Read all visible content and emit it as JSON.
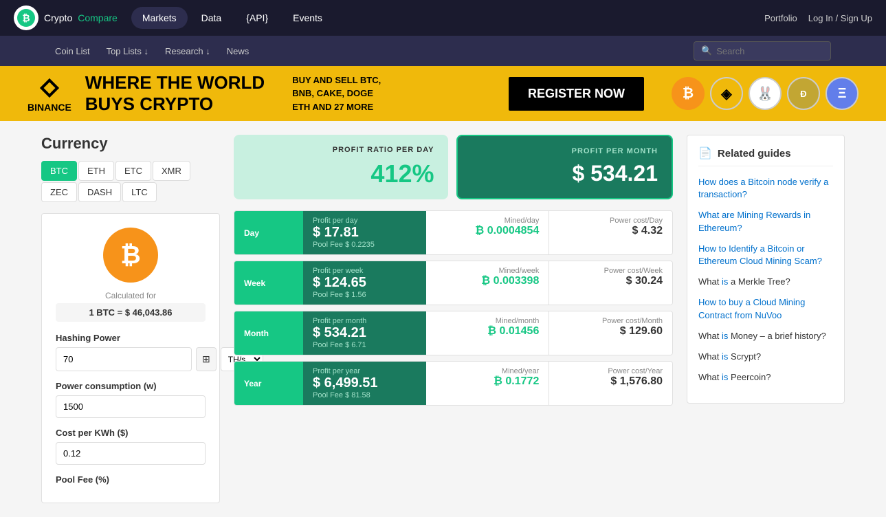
{
  "header": {
    "logo_text_crypto": "Crypto",
    "logo_text_compare": "Compare",
    "nav_items": [
      {
        "label": "Markets",
        "active": true
      },
      {
        "label": "Data"
      },
      {
        "label": "{API}"
      },
      {
        "label": "Events"
      }
    ],
    "portfolio": "Portfolio",
    "login": "Log In / Sign Up"
  },
  "secondary_nav": {
    "items": [
      {
        "label": "Coin List"
      },
      {
        "label": "Top Lists ↓"
      },
      {
        "label": "Research ↓"
      },
      {
        "label": "News"
      }
    ],
    "search_placeholder": "Search"
  },
  "banner": {
    "brand": "BINANCE",
    "headline_line1": "WHERE THE WORLD",
    "headline_line2": "BUYS CRYPTO",
    "sub_text": "BUY AND SELL BTC, BNB, CAKE, DOGE\nETH AND 27 MORE",
    "cta_button": "REGISTER NOW"
  },
  "page": {
    "currency_label": "Currency",
    "tabs": [
      {
        "label": "BTC",
        "active": true
      },
      {
        "label": "ETH"
      },
      {
        "label": "ETC"
      },
      {
        "label": "XMR"
      },
      {
        "label": "ZEC"
      },
      {
        "label": "DASH"
      },
      {
        "label": "LTC"
      }
    ],
    "btc_symbol": "₿",
    "calc_label": "Calculated for",
    "calc_value": "1 BTC = $ 46,043.86",
    "hashing_power_label": "Hashing Power",
    "hashing_value": "70",
    "hashing_unit": "TH/s",
    "power_consumption_label": "Power consumption (w)",
    "power_value": "1500",
    "cost_per_kwh_label": "Cost per KWh ($)",
    "cost_value": "0.12",
    "pool_fee_label": "Pool Fee (%)"
  },
  "profit": {
    "day_label": "PROFIT RATIO PER DAY",
    "day_value": "412%",
    "month_label": "PROFIT PER MONTH",
    "month_value": "$ 534.21",
    "rows": [
      {
        "period": "Day",
        "title": "Profit per day",
        "value": "$ 17.81",
        "pool_fee": "Pool Fee $ 0.2235",
        "mined_label": "Mined/day",
        "mined_value": "₿ 0.0004854",
        "power_label": "Power cost/Day",
        "power_value": "$ 4.32"
      },
      {
        "period": "Week",
        "title": "Profit per week",
        "value": "$ 124.65",
        "pool_fee": "Pool Fee $ 1.56",
        "mined_label": "Mined/week",
        "mined_value": "₿ 0.003398",
        "power_label": "Power cost/Week",
        "power_value": "$ 30.24"
      },
      {
        "period": "Month",
        "title": "Profit per month",
        "value": "$ 534.21",
        "pool_fee": "Pool Fee $ 6.71",
        "mined_label": "Mined/month",
        "mined_value": "₿ 0.01456",
        "power_label": "Power cost/Month",
        "power_value": "$ 129.60"
      },
      {
        "period": "Year",
        "title": "Profit per year",
        "value": "$ 6,499.51",
        "pool_fee": "Pool Fee $ 81.58",
        "mined_label": "Mined/year",
        "mined_value": "₿ 0.1772",
        "power_label": "Power cost/Year",
        "power_value": "$ 1,576.80"
      }
    ]
  },
  "guides": {
    "header": "Related guides",
    "items": [
      {
        "text": "How does a Bitcoin node verify a transaction?"
      },
      {
        "text": "What are Mining Rewards in Ethereum?"
      },
      {
        "text": "How to Identify a Bitcoin or Ethereum Cloud Mining Scam?"
      },
      {
        "text": "What is a Merkle Tree?"
      },
      {
        "text": "How to buy a Cloud Mining Contract from NuVoo"
      },
      {
        "text": "What is Money – a brief history?"
      },
      {
        "text": "What is Scrypt?"
      },
      {
        "text": "What is Peercoin?"
      }
    ]
  }
}
